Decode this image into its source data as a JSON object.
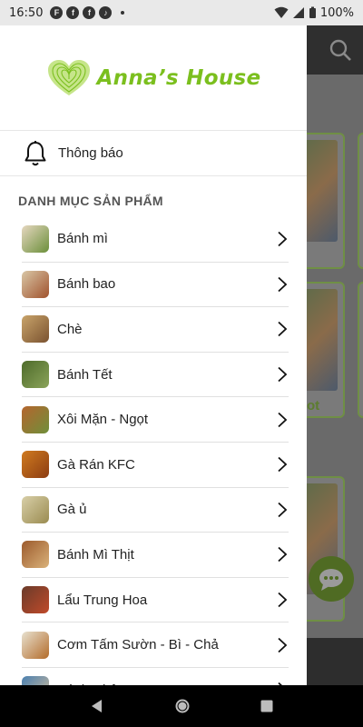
{
  "status_bar": {
    "time": "16:50",
    "battery": "100%"
  },
  "drawer": {
    "logo_text": "Anna’s House",
    "notification_label": "Thông báo",
    "section_title": "DANH MỤC SẢN PHẨM",
    "categories": [
      {
        "label": "Bánh mì",
        "thumb_colors": [
          "#e6d7c0",
          "#6b8f3a"
        ]
      },
      {
        "label": "Bánh bao",
        "thumb_colors": [
          "#d9c7a6",
          "#a0522d"
        ]
      },
      {
        "label": "Chè",
        "thumb_colors": [
          "#c9a46a",
          "#7a5230"
        ]
      },
      {
        "label": "Bánh Tết",
        "thumb_colors": [
          "#4e6b2a",
          "#8aa35a"
        ]
      },
      {
        "label": "Xôi Mặn - Ngọt",
        "thumb_colors": [
          "#b5652e",
          "#6f8f3a"
        ]
      },
      {
        "label": "Gà Rán KFC",
        "thumb_colors": [
          "#d07a1f",
          "#8c3d12"
        ]
      },
      {
        "label": "Gà ủ",
        "thumb_colors": [
          "#d8cfa8",
          "#9a8b50"
        ]
      },
      {
        "label": "Bánh Mì Thịt",
        "thumb_colors": [
          "#9c5a2c",
          "#d9b27a"
        ]
      },
      {
        "label": "Lẩu Trung Hoa",
        "thumb_colors": [
          "#6a3b2a",
          "#c04a2a"
        ]
      },
      {
        "label": "Cơm Tấm Sườn - Bì - Chả",
        "thumb_colors": [
          "#e8e2d0",
          "#b36b2a"
        ]
      },
      {
        "label": "Bánh Nhật",
        "thumb_colors": [
          "#4a7fb0",
          "#d9c09a"
        ]
      }
    ]
  },
  "background": {
    "partial_label": "ot"
  },
  "colors": {
    "brand_green": "#7bbf1e",
    "drawer_bg": "#ffffff",
    "scrim": "#6a6a6a"
  }
}
